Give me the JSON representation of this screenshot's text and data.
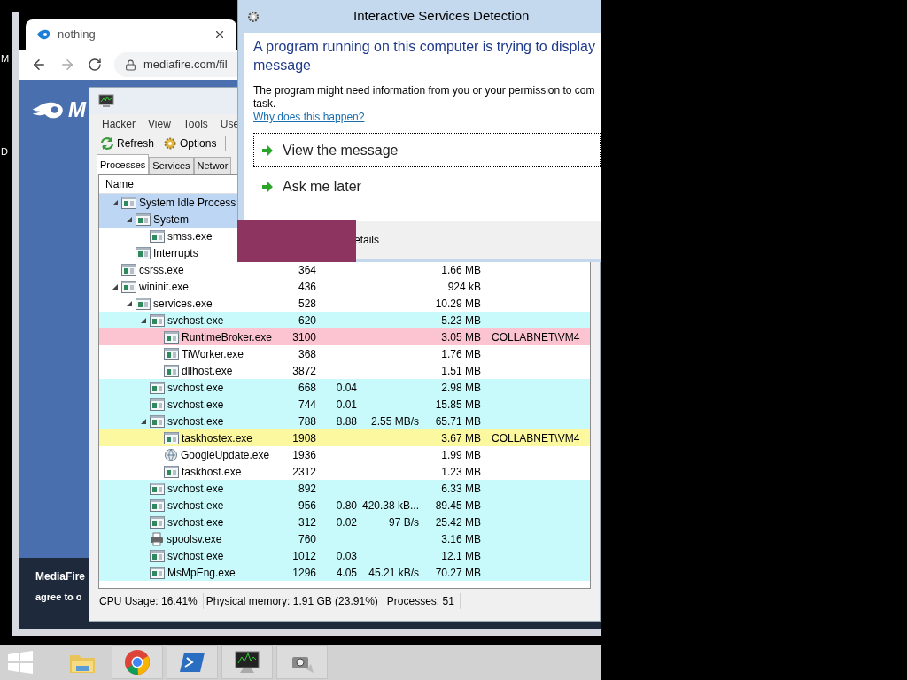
{
  "desktop": {
    "labels": [
      "M",
      "D"
    ]
  },
  "browser": {
    "tab_title": "nothing",
    "url": "mediafire.com/fil",
    "logo_text": "M",
    "footer_lines": [
      "MediaFire",
      "agree to o"
    ]
  },
  "process_hacker": {
    "menu": [
      "Hacker",
      "View",
      "Tools",
      "Use"
    ],
    "toolbar": [
      "Refresh",
      "Options"
    ],
    "tabs": [
      {
        "label": "Processes",
        "selected": true
      },
      {
        "label": "Services",
        "selected": false
      },
      {
        "label": "Networ",
        "selected": false
      }
    ],
    "column_header": "Name",
    "processes": [
      {
        "name": "System Idle Process",
        "kind": "app",
        "selected": true,
        "expanded": true,
        "children": [
          {
            "name": "System",
            "kind": "app",
            "selected": true,
            "expanded": true,
            "children": [
              {
                "name": "smss.exe",
                "kind": "app",
                "selected": false
              }
            ]
          },
          {
            "name": "Interrupts",
            "kind": "app",
            "selected": false
          }
        ]
      },
      {
        "name": "csrss.exe",
        "kind": "app",
        "selected": false,
        "pid": "364",
        "memory": "1.66 MB"
      },
      {
        "name": "wininit.exe",
        "kind": "app",
        "selected": false,
        "expanded": true,
        "pid": "436",
        "memory": "924 kB",
        "children": [
          {
            "name": "services.exe",
            "kind": "app",
            "selected": false,
            "expanded": true,
            "pid": "528",
            "memory": "10.29 MB",
            "children": [
              {
                "name": "svchost.exe",
                "kind": "app",
                "selected": false,
                "expanded": true,
                "color": "#c8fafc",
                "pid": "620",
                "memory": "5.23 MB",
                "children": [
                  {
                    "name": "RuntimeBroker.exe",
                    "kind": "app",
                    "selected": false,
                    "color": "#fcc4d0",
                    "pid": "3100",
                    "memory": "3.05 MB",
                    "user": "COLLABNET\\VM4"
                  },
                  {
                    "name": "TiWorker.exe",
                    "kind": "app",
                    "selected": false,
                    "pid": "368",
                    "memory": "1.76 MB"
                  },
                  {
                    "name": "dllhost.exe",
                    "kind": "app",
                    "selected": false,
                    "pid": "3872",
                    "memory": "1.51 MB"
                  }
                ]
              },
              {
                "name": "svchost.exe",
                "kind": "app",
                "selected": false,
                "color": "#c8fafc",
                "pid": "668",
                "cpu": "0.04",
                "memory": "2.98 MB"
              },
              {
                "name": "svchost.exe",
                "kind": "app",
                "selected": false,
                "color": "#c8fafc",
                "pid": "744",
                "cpu": "0.01",
                "memory": "15.85 MB"
              },
              {
                "name": "svchost.exe",
                "kind": "app",
                "selected": false,
                "expanded": true,
                "color": "#c8fafc",
                "pid": "788",
                "cpu": "8.88",
                "io": "2.55 MB/s",
                "memory": "65.71 MB",
                "children": [
                  {
                    "name": "taskhostex.exe",
                    "kind": "app",
                    "selected": false,
                    "color": "#fcf8a0",
                    "pid": "1908",
                    "memory": "3.67 MB",
                    "user": "COLLABNET\\VM4"
                  },
                  {
                    "name": "GoogleUpdate.exe",
                    "kind": "updater",
                    "selected": false,
                    "pid": "1936",
                    "memory": "1.99 MB"
                  },
                  {
                    "name": "taskhost.exe",
                    "kind": "app",
                    "selected": false,
                    "pid": "2312",
                    "memory": "1.23 MB"
                  }
                ]
              },
              {
                "name": "svchost.exe",
                "kind": "app",
                "selected": false,
                "color": "#c8fafc",
                "pid": "892",
                "memory": "6.33 MB"
              },
              {
                "name": "svchost.exe",
                "kind": "app",
                "selected": false,
                "color": "#c8fafc",
                "pid": "956",
                "cpu": "0.80",
                "io": "420.38 kB...",
                "memory": "89.45 MB"
              },
              {
                "name": "svchost.exe",
                "kind": "app",
                "selected": false,
                "color": "#c8fafc",
                "pid": "312",
                "cpu": "0.02",
                "io": "97 B/s",
                "memory": "25.42 MB"
              },
              {
                "name": "spoolsv.exe",
                "kind": "printer",
                "selected": false,
                "color": "#c8fafc",
                "pid": "760",
                "memory": "3.16 MB"
              },
              {
                "name": "svchost.exe",
                "kind": "app",
                "selected": false,
                "color": "#c8fafc",
                "pid": "1012",
                "cpu": "0.03",
                "memory": "12.1 MB"
              },
              {
                "name": "MsMpEng.exe",
                "kind": "app",
                "selected": false,
                "color": "#c8fafc",
                "pid": "1296",
                "cpu": "4.05",
                "io": "45.21 kB/s",
                "memory": "70.27 MB"
              }
            ]
          }
        ]
      }
    ],
    "status": [
      "CPU Usage: 16.41%",
      "Physical memory: 1.91 GB (23.91%)",
      "Processes: 51"
    ]
  },
  "dialog": {
    "title": "Interactive Services Detection",
    "heading_lines": [
      "A program running on this computer is trying to display",
      "message"
    ],
    "body_lines": [
      "The program might need information from you or your permission to com",
      "task."
    ],
    "link": "Why does this happen?",
    "options": [
      {
        "label": "View the message",
        "focused": true
      },
      {
        "label": "Ask me later",
        "focused": false
      }
    ],
    "footer_button": "etails"
  }
}
